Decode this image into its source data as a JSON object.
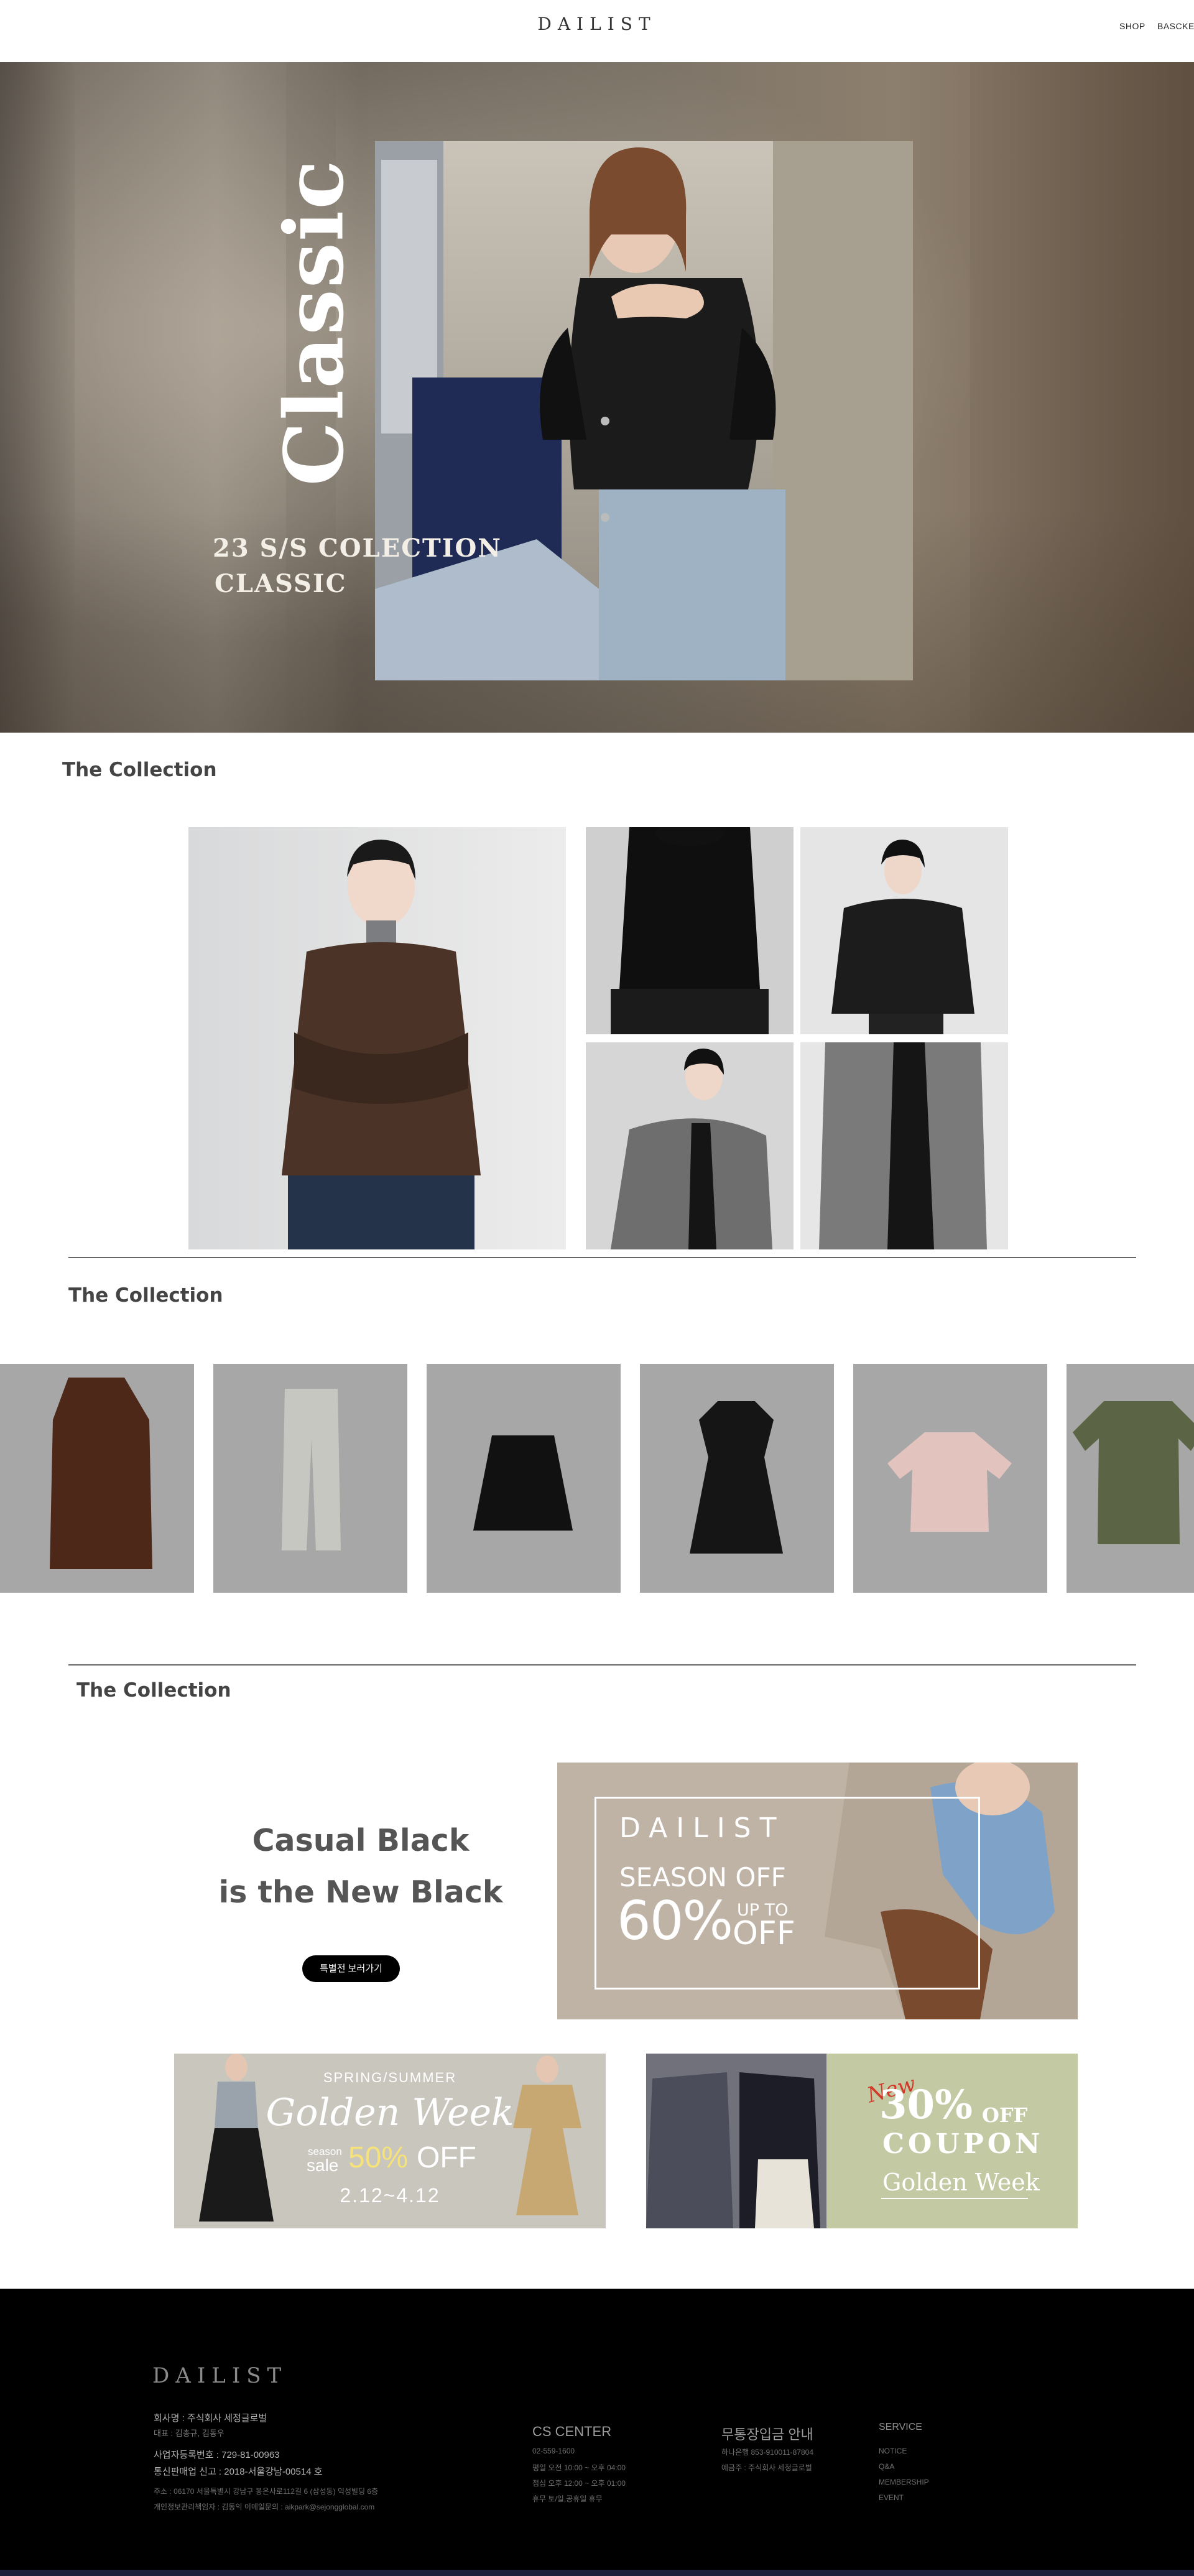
{
  "header": {
    "logo": "DAILIST",
    "nav": [
      "SHOP",
      "BASCKET"
    ]
  },
  "hero": {
    "title": "Classic",
    "subtitle_line1": "23 S/S COLECTION",
    "subtitle_line2": "CLASSIC"
  },
  "sections": {
    "collection1_title": "The Collection",
    "collection2_title": "The Collection",
    "collection3_title": "The Collection"
  },
  "products": [
    {
      "name": "coat-product",
      "color": "#4d2718"
    },
    {
      "name": "cargo-pants-product",
      "color": "#c6c7c1"
    },
    {
      "name": "pleated-skirt-product",
      "color": "#111111"
    },
    {
      "name": "black-dress-product",
      "color": "#151515"
    },
    {
      "name": "pink-shirt-product",
      "color": "#e3c3bd"
    },
    {
      "name": "olive-tshirt-product",
      "color": "#5c6446"
    }
  ],
  "promo": {
    "line1": "Casual Black",
    "line2": "is the New Black",
    "button": "특별전 보러가기",
    "season_banner": {
      "logo": "DAILIST",
      "line1": "SEASON OFF",
      "percent": "60%",
      "upto": "UP TO",
      "off": "OFF"
    }
  },
  "banners": {
    "golden_week": {
      "top": "SPRING/SUMMER",
      "script": "Golden Week",
      "season": "season",
      "sale": "sale",
      "percent": "50%",
      "off": "OFF",
      "dates": "2.12~4.12"
    },
    "coupon": {
      "new": "New",
      "percent": "30%",
      "off": "OFF",
      "coupon": "COUPON",
      "script": "Golden Week"
    }
  },
  "footer": {
    "logo": "DAILIST",
    "company": "회사명 : 주식회사 세정글로벌",
    "ceo": "대표 : 김총규, 김동우",
    "biz_no": "사업자등록번호 : 729-81-00963",
    "mail_order": "통신판매업 신고 : 2018-서울강남-00514 호",
    "address": "주소 : 06170 서울특별시 강남구 봉은사로112길 6 (삼성동) 익성빌딩 6층",
    "privacy": "개인정보관리책임자 : 김동익 이메일문의 : aikpark@sejongglobal.com",
    "cs_title": "CS CENTER",
    "cs_phone": "02-559-1600",
    "cs_hours1": "평일 오전 10:00 ~ 오후 04:00",
    "cs_hours2": "점심 오후 12:00 ~ 오후 01:00",
    "cs_hours3": "휴무 토/일,공휴일 휴무",
    "bank_title": "무통장입금 안내",
    "bank_account": "하나은행 853-910011-87804",
    "bank_holder": "예금주 : 주식회사 세정글로벌",
    "service_title": "SERVICE",
    "service_links": [
      "NOTICE",
      "Q&A",
      "MEMBERSHIP",
      "EVENT"
    ]
  }
}
